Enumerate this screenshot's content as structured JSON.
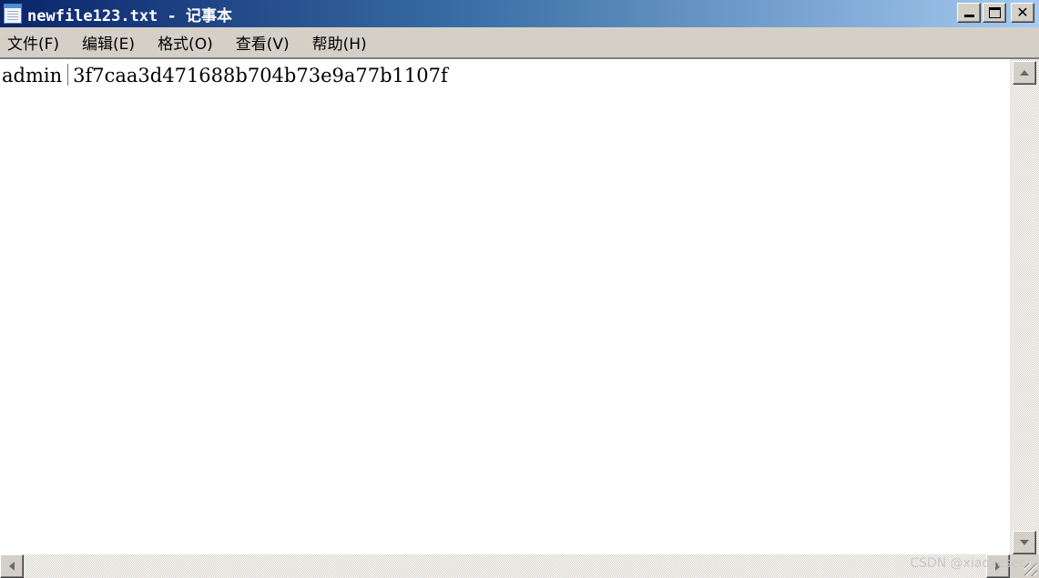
{
  "window": {
    "title": "newfile123.txt - 记事本",
    "icon": "notepad-icon",
    "controls": {
      "minimize": "minimize-icon",
      "maximize": "maximize-icon",
      "close_glyph": "✕"
    }
  },
  "menu": {
    "items": [
      {
        "label": "文件(F)"
      },
      {
        "label": "编辑(E)"
      },
      {
        "label": "格式(O)"
      },
      {
        "label": "查看(V)"
      },
      {
        "label": "帮助(H)"
      }
    ]
  },
  "editor": {
    "line_user": "admin",
    "line_hash": "3f7caa3d471688b704b73e9a77b1107f"
  },
  "watermark": "CSDN @xiaojiesec",
  "colors": {
    "title_start": "#0a246a",
    "title_end": "#a6caf0",
    "chrome": "#d4d0c8"
  }
}
